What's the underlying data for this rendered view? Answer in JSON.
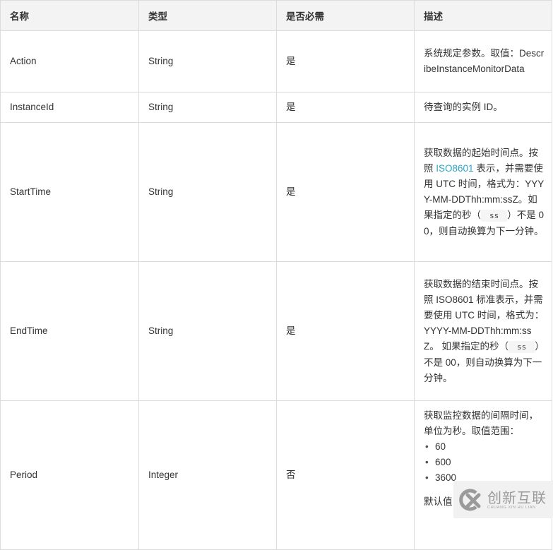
{
  "table": {
    "headers": [
      "名称",
      "类型",
      "是否必需",
      "描述"
    ],
    "rows": [
      {
        "name": "Action",
        "type": "String",
        "required": "是",
        "desc_text": "系统规定参数。取值：DescribeInstanceMonitorData"
      },
      {
        "name": "InstanceId",
        "type": "String",
        "required": "是",
        "desc_text": "待查询的实例 ID。"
      },
      {
        "name": "StartTime",
        "type": "String",
        "required": "是",
        "desc_pre": "获取数据的起始时间点。按照 ",
        "desc_link": "ISO8601",
        "desc_mid": " 表示，并需要使用 UTC 时间，格式为：YYYY-MM-DDThh:mm:ssZ。如果指定的秒（",
        "desc_code": "ss",
        "desc_post": "）不是 00，则自动换算为下一分钟。"
      },
      {
        "name": "EndTime",
        "type": "String",
        "required": "是",
        "desc_pre": "获取数据的结束时间点。按照 ISO8601 标准表示，并需要使用 UTC 时间，格式为：YYYY-MM-DDThh:mm:ssZ。 如果指定的秒（",
        "desc_code": "ss",
        "desc_post": "）不是 00，则自动换算为下一分钟。"
      },
      {
        "name": "Period",
        "type": "Integer",
        "required": "否",
        "desc_text": "获取监控数据的间隔时间，单位为秒。取值范围：",
        "desc_options": [
          "60",
          "600",
          "3600"
        ],
        "desc_default": "默认值"
      }
    ]
  },
  "watermark": {
    "cn": "创新互联",
    "en": "CHUANG XIN HU LIAN",
    "icon": "cx-logo-icon"
  }
}
